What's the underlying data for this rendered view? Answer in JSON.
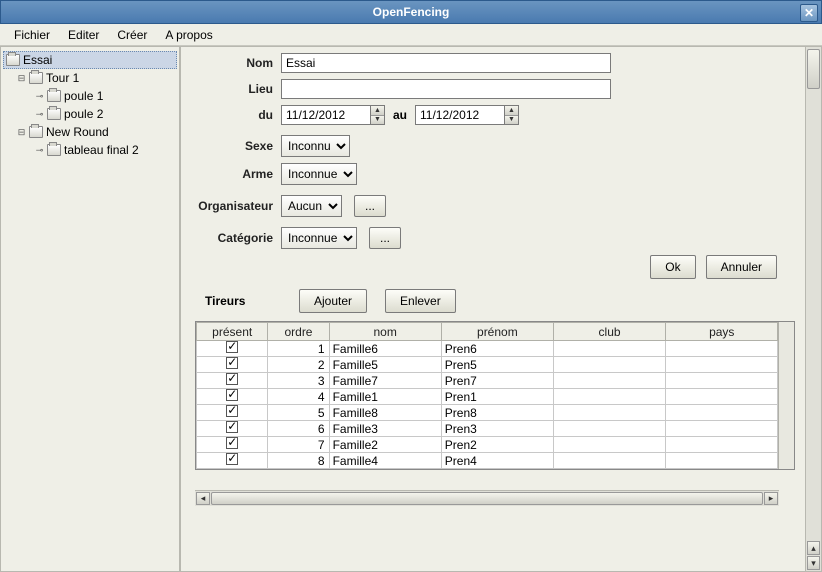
{
  "window": {
    "title": "OpenFencing"
  },
  "menu": {
    "items": [
      "Fichier",
      "Editer",
      "Créer",
      "A propos"
    ]
  },
  "tree": {
    "root": "Essai",
    "items": [
      {
        "label": "Tour 1",
        "children": [
          "poule 1",
          "poule 2"
        ]
      },
      {
        "label": "New Round",
        "children": [
          "tableau final 2"
        ]
      }
    ]
  },
  "form": {
    "nom_label": "Nom",
    "nom_value": "Essai",
    "lieu_label": "Lieu",
    "lieu_value": "",
    "du_label": "du",
    "date_from": "11/12/2012",
    "au_label": "au",
    "date_to": "11/12/2012",
    "sexe_label": "Sexe",
    "sexe_value": "Inconnu",
    "arme_label": "Arme",
    "arme_value": "Inconnue",
    "org_label": "Organisateur",
    "org_value": "Aucun",
    "cat_label": "Catégorie",
    "cat_value": "Inconnue",
    "more_btn": "...",
    "ok": "Ok",
    "cancel": "Annuler"
  },
  "tireurs": {
    "label": "Tireurs",
    "add": "Ajouter",
    "remove": "Enlever",
    "columns": [
      "présent",
      "ordre",
      "nom",
      "prénom",
      "club",
      "pays"
    ],
    "rows": [
      {
        "present": true,
        "ordre": 1,
        "nom": "Famille6",
        "prenom": "Pren6",
        "club": "",
        "pays": ""
      },
      {
        "present": true,
        "ordre": 2,
        "nom": "Famille5",
        "prenom": "Pren5",
        "club": "",
        "pays": ""
      },
      {
        "present": true,
        "ordre": 3,
        "nom": "Famille7",
        "prenom": "Pren7",
        "club": "",
        "pays": ""
      },
      {
        "present": true,
        "ordre": 4,
        "nom": "Famille1",
        "prenom": "Pren1",
        "club": "",
        "pays": ""
      },
      {
        "present": true,
        "ordre": 5,
        "nom": "Famille8",
        "prenom": "Pren8",
        "club": "",
        "pays": ""
      },
      {
        "present": true,
        "ordre": 6,
        "nom": "Famille3",
        "prenom": "Pren3",
        "club": "",
        "pays": ""
      },
      {
        "present": true,
        "ordre": 7,
        "nom": "Famille2",
        "prenom": "Pren2",
        "club": "",
        "pays": ""
      },
      {
        "present": true,
        "ordre": 8,
        "nom": "Famille4",
        "prenom": "Pren4",
        "club": "",
        "pays": ""
      }
    ]
  }
}
